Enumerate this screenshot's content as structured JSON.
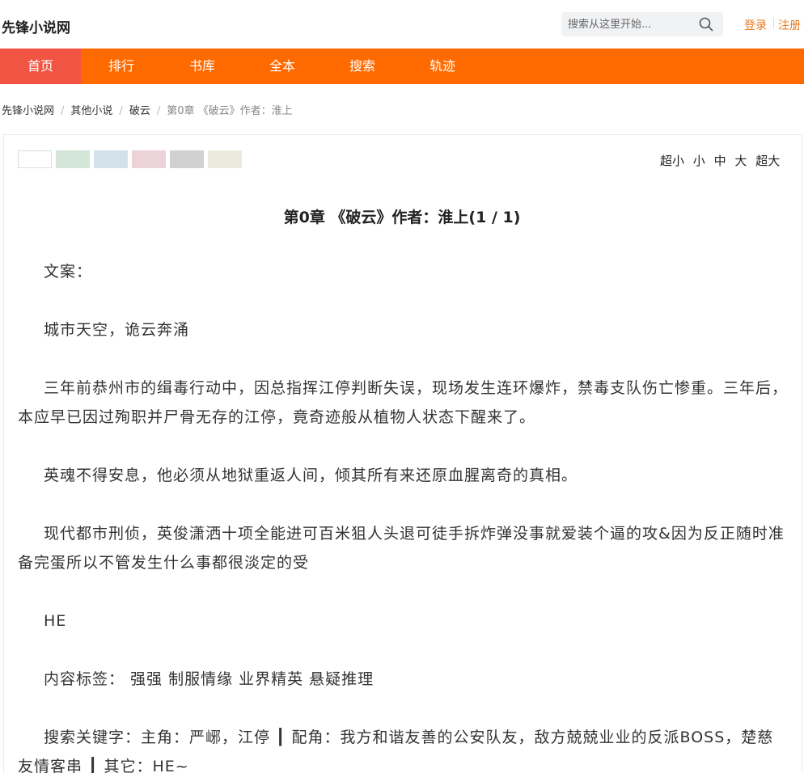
{
  "header": {
    "site_name": "先锋小说网",
    "search_placeholder": "搜索从这里开始...",
    "login": "登录",
    "register": "注册"
  },
  "nav": {
    "items": [
      {
        "label": "首页",
        "active": true
      },
      {
        "label": "排行"
      },
      {
        "label": "书库"
      },
      {
        "label": "全本"
      },
      {
        "label": "搜索"
      },
      {
        "label": "轨迹"
      }
    ]
  },
  "breadcrumb": {
    "items": [
      "先锋小说网",
      "其他小说",
      "破云"
    ],
    "current": "第0章 《破云》作者：淮上"
  },
  "reader": {
    "swatches": [
      "#ffffff",
      "#d4e6d8",
      "#d3e2e8",
      "#ecd3d7",
      "#d1d1d1",
      "#ebeadf"
    ],
    "font_sizes": [
      "超小",
      "小",
      "中",
      "大",
      "超大"
    ]
  },
  "chapter": {
    "title": "第0章 《破云》作者：淮上(1 / 1)",
    "paragraphs": [
      "文案：",
      "城市天空，诡云奔涌",
      "三年前恭州市的缉毒行动中，因总指挥江停判断失误，现场发生连环爆炸，禁毒支队伤亡惨重。三年后，本应早已因过殉职并尸骨无存的江停，竟奇迹般从植物人状态下醒来了。",
      "英魂不得安息，他必须从地狱重返人间，倾其所有来还原血腥离奇的真相。",
      "现代都市刑侦，英俊潇洒十项全能进可百米狙人头退可徒手拆炸弹没事就爱装个逼的攻&因为反正随时准备完蛋所以不管发生什么事都很淡定的受",
      "HE",
      "内容标签： 强强 制服情缘 业界精英 悬疑推理",
      "搜索关键字：主角：严峫，江停 ┃ 配角：我方和谐友善的公安队友，敌方兢兢业业的反派BOSS，楚慈友情客串 ┃ 其它：HE~"
    ]
  }
}
